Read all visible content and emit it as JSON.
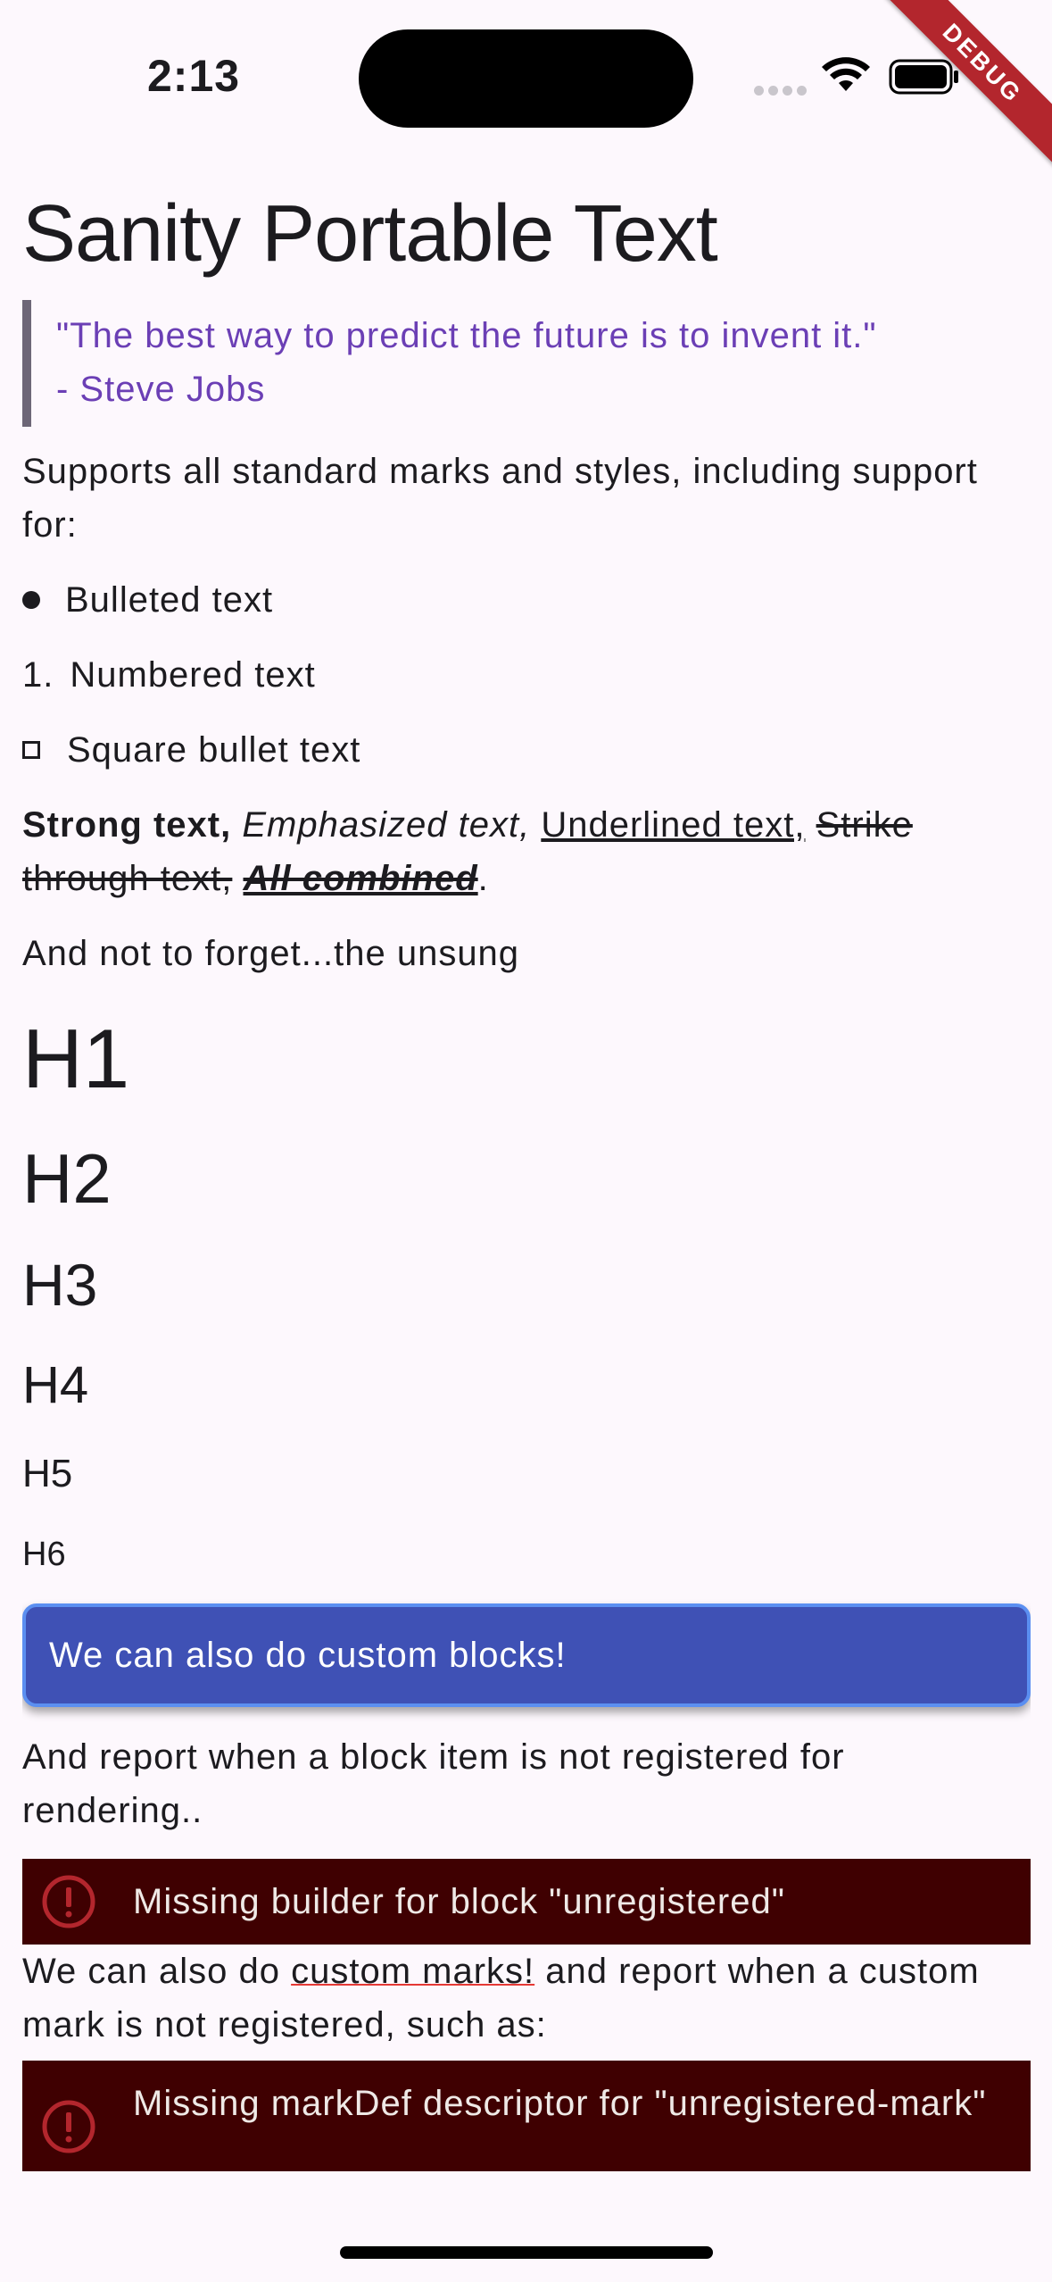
{
  "status_bar": {
    "time": "2:13",
    "debug_banner": "DEBUG"
  },
  "page": {
    "title": "Sanity Portable Text",
    "quote": {
      "line1": "\"The best way to predict the future is to invent it.\"",
      "line2": "- Steve Jobs"
    },
    "intro": "Supports all standard marks and styles, including support for:",
    "list": {
      "bullet": "Bulleted text",
      "number_marker": "1.",
      "numbered": "Numbered text",
      "square": "Square bullet text"
    },
    "marks": {
      "strong": "Strong text,",
      "emphasized": "Emphasized text,",
      "underlined": "Underlined text,",
      "strike": "Strike through text,",
      "combined": "All combined",
      "period": "."
    },
    "unsung": "And not to forget...the unsung",
    "headings": {
      "h1": "H1",
      "h2": "H2",
      "h3": "H3",
      "h4": "H4",
      "h5": "H5",
      "h6": "H6"
    },
    "custom_block": "We can also do custom blocks!",
    "report_text": "And report when a block item is not registered for rendering..",
    "error_block": "Missing builder for block \"unregistered\"",
    "custom_marks": {
      "before": "We can also do ",
      "link": "custom marks!",
      "after": " and report when a custom mark is not registered, such as:"
    },
    "error_mark": "Missing markDef descriptor for \"unregistered-mark\""
  },
  "colors": {
    "background": "#fdf8fd",
    "quote_text": "#6b3fb5",
    "custom_block": "#3f51b5",
    "error_bg": "#3f0001",
    "error_icon": "#b3262d",
    "debug": "#b3262d"
  }
}
